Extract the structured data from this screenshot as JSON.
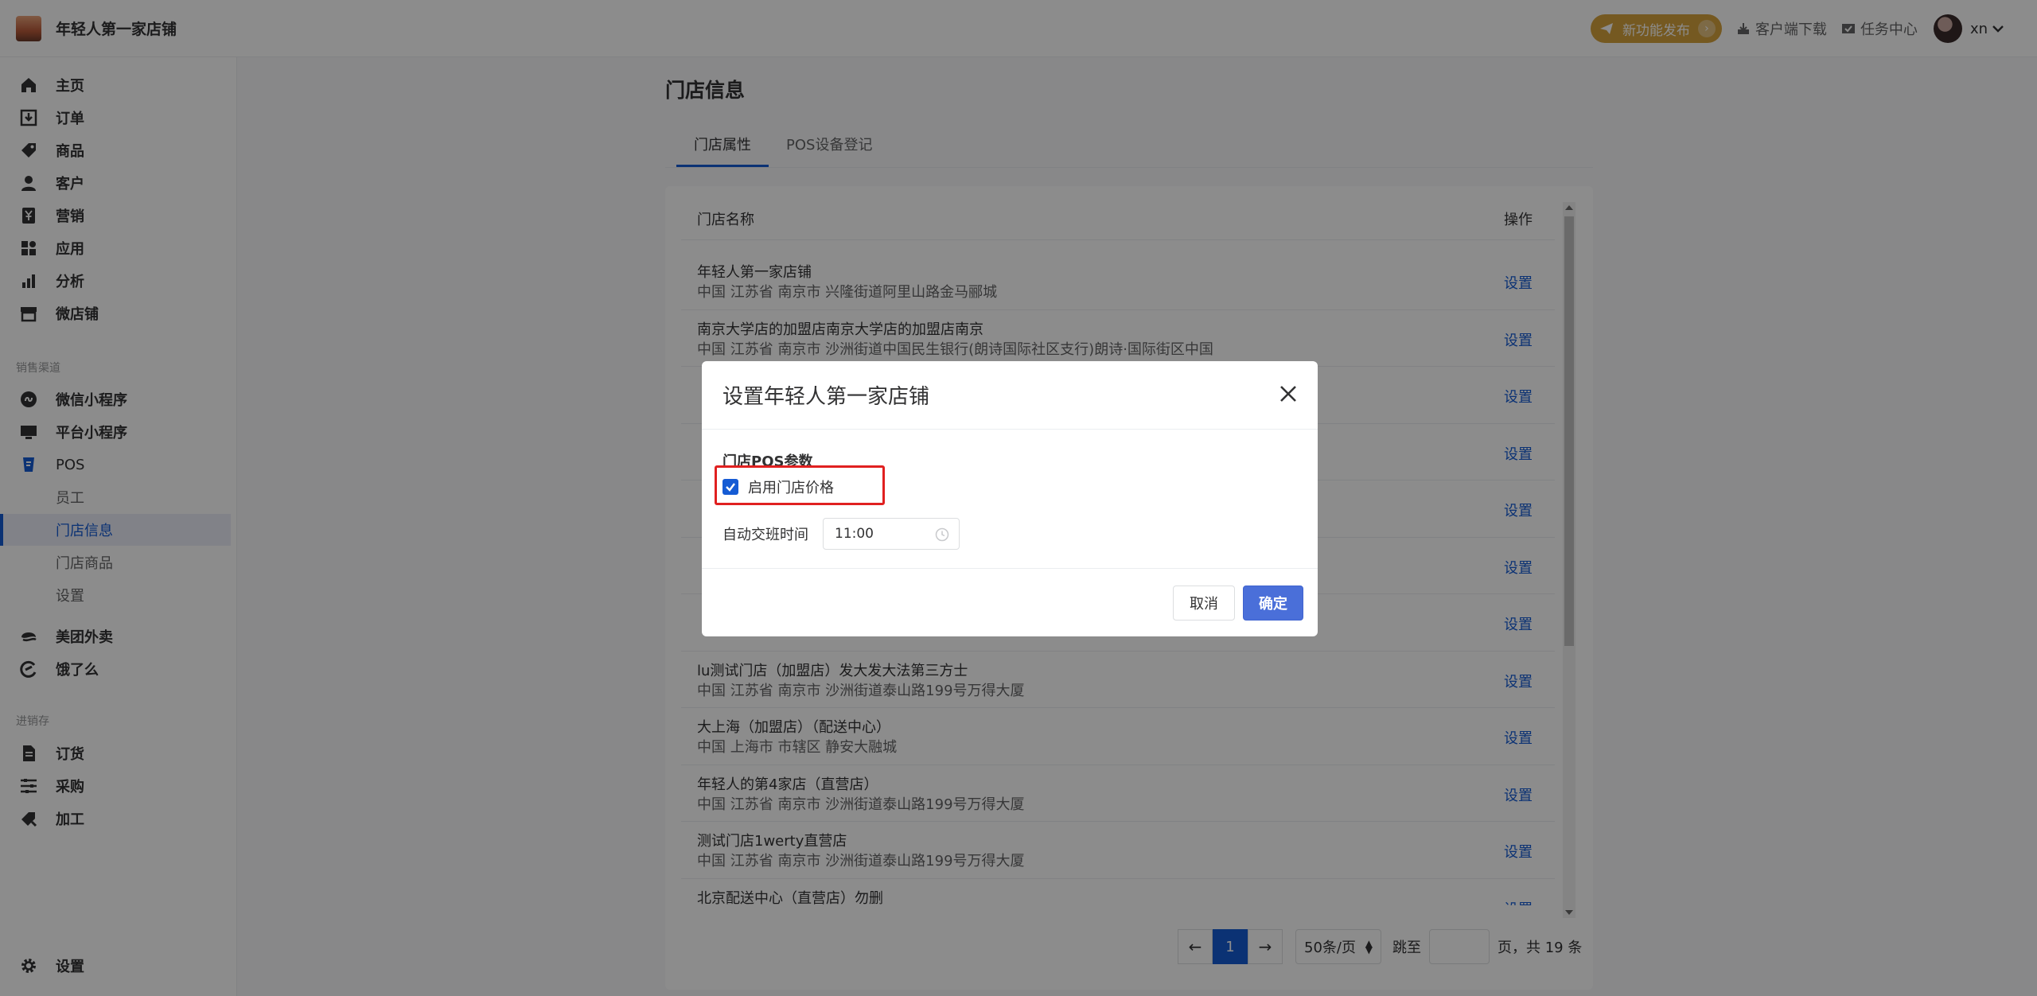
{
  "brand": {
    "name": "年轻人第一家店铺"
  },
  "topbar": {
    "new_feature": "新功能发布",
    "client_download": "客户端下载",
    "task_center": "任务中心",
    "user": "xn"
  },
  "sidebar": {
    "items": [
      {
        "label": "主页",
        "icon": "home-icon"
      },
      {
        "label": "订单",
        "icon": "order-icon"
      },
      {
        "label": "商品",
        "icon": "tag-icon"
      },
      {
        "label": "客户",
        "icon": "person-icon"
      },
      {
        "label": "营销",
        "icon": "yen-icon"
      },
      {
        "label": "应用",
        "icon": "apps-icon"
      },
      {
        "label": "分析",
        "icon": "bar-chart-icon"
      },
      {
        "label": "微店铺",
        "icon": "store-icon"
      }
    ],
    "channel_group": "销售渠道",
    "channels": [
      {
        "label": "微信小程序",
        "icon": "miniprogram-icon"
      },
      {
        "label": "平台小程序",
        "icon": "monitor-icon"
      },
      {
        "label": "POS",
        "icon": "pos-icon"
      }
    ],
    "pos_sub": [
      {
        "label": "员工",
        "active": false
      },
      {
        "label": "门店信息",
        "active": true
      },
      {
        "label": "门店商品",
        "active": false
      },
      {
        "label": "设置",
        "active": false
      }
    ],
    "delivery": [
      {
        "label": "美团外卖",
        "icon": "meituan-icon"
      },
      {
        "label": "饿了么",
        "icon": "eleme-icon"
      }
    ],
    "inventory_group": "进销存",
    "inventory": [
      {
        "label": "订货",
        "icon": "document-icon"
      },
      {
        "label": "采购",
        "icon": "purchase-icon"
      },
      {
        "label": "加工",
        "icon": "process-icon"
      }
    ],
    "settings": "设置"
  },
  "page": {
    "title": "门店信息",
    "tabs": [
      {
        "label": "门店属性",
        "active": true
      },
      {
        "label": "POS设备登记",
        "active": false
      }
    ]
  },
  "table": {
    "col_name": "门店名称",
    "col_op": "操作",
    "rows": [
      {
        "name": "年轻人第一家店铺",
        "addr": "中国 江苏省 南京市 兴隆街道阿里山路金马郦城",
        "op": "设置"
      },
      {
        "name": "南京大学店的加盟店南京大学店的加盟店南京",
        "addr": "中国 江苏省 南京市 沙洲街道中国民生银行(朗诗国际社区支行)朗诗·国际街区中国",
        "op": "设置"
      },
      {
        "name": "",
        "addr": "",
        "op": "设置"
      },
      {
        "name": "",
        "addr": "",
        "op": "设置"
      },
      {
        "name": "",
        "addr": "",
        "op": "设置"
      },
      {
        "name": "",
        "addr": "",
        "op": "设置"
      },
      {
        "name": "",
        "addr": "",
        "op": "设置"
      },
      {
        "name": "lu测试门店（加盟店）发大发大法第三方士",
        "addr": "中国 江苏省 南京市 沙洲街道泰山路199号万得大厦",
        "op": "设置"
      },
      {
        "name": "大上海（加盟店）（配送中心）",
        "addr": "中国 上海市 市辖区 静安大融城",
        "op": "设置"
      },
      {
        "name": "年轻人的第4家店（直营店）",
        "addr": "中国 江苏省 南京市 沙洲街道泰山路199号万得大厦",
        "op": "设置"
      },
      {
        "name": "测试门店1werty直营店",
        "addr": "中国 江苏省 南京市 沙洲街道泰山路199号万得大厦",
        "op": "设置"
      },
      {
        "name": "北京配送中心（直营店）勿删",
        "addr": "",
        "op": "设置"
      }
    ]
  },
  "pagination": {
    "current": "1",
    "page_size": "50条/页",
    "jump_label": "跳至",
    "total": "页，共 19 条"
  },
  "modal": {
    "title": "设置年轻人第一家店铺",
    "section_title": "门店POS参数",
    "checkbox_label": "启用门店价格",
    "checkbox_checked": true,
    "time_label": "自动交班时间",
    "time_value": "11:00",
    "cancel": "取消",
    "ok": "确定"
  },
  "colors": {
    "accent": "#155bd4",
    "feature_badge": "#d6a23c",
    "highlight_box": "#e02020"
  }
}
